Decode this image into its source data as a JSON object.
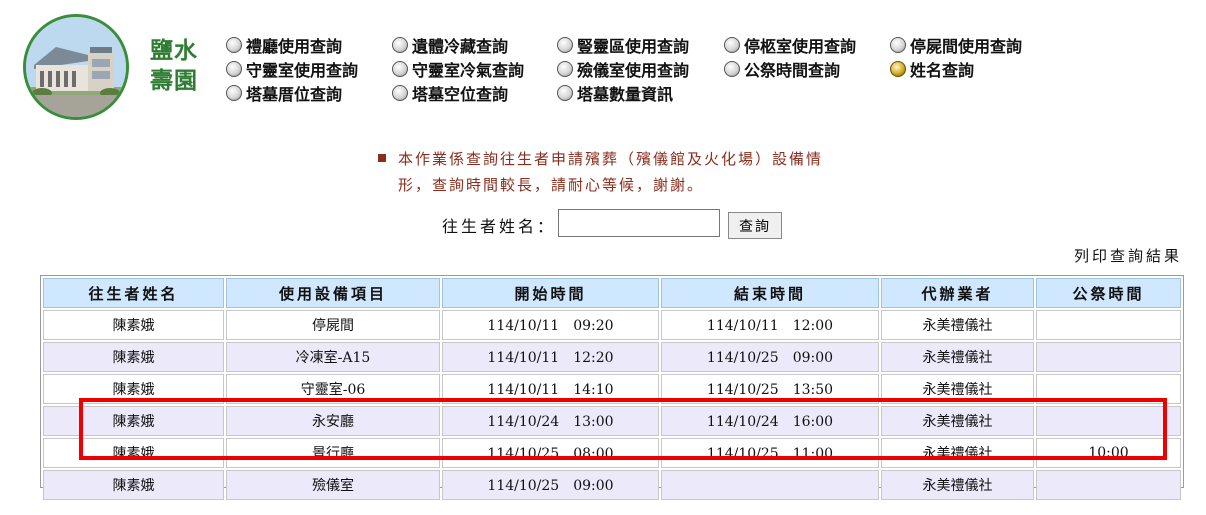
{
  "brand": {
    "line1": "鹽水",
    "line2": "壽園"
  },
  "nav": [
    {
      "label": "禮廳使用查詢",
      "selected": false
    },
    {
      "label": "遺體冷藏查詢",
      "selected": false
    },
    {
      "label": "豎靈區使用查詢",
      "selected": false
    },
    {
      "label": "停柩室使用查詢",
      "selected": false
    },
    {
      "label": "停屍間使用查詢",
      "selected": false
    },
    {
      "label": "守靈室使用查詢",
      "selected": false
    },
    {
      "label": "守靈室冷氣查詢",
      "selected": false
    },
    {
      "label": "殮儀室使用查詢",
      "selected": false
    },
    {
      "label": "公祭時間查詢",
      "selected": false
    },
    {
      "label": "姓名查詢",
      "selected": true
    },
    {
      "label": "塔墓厝位查詢",
      "selected": false
    },
    {
      "label": "塔墓空位查詢",
      "selected": false
    },
    {
      "label": "塔墓數量資訊",
      "selected": false
    }
  ],
  "notice": {
    "line1": "本作業係查詢往生者申請殯葬（殯儀館及火化場）設備情",
    "line2": "形，查詢時間較長，請耐心等候，謝謝。"
  },
  "search": {
    "label": "往生者姓名：",
    "value": "",
    "button": "查詢"
  },
  "print_label": "列印查詢結果",
  "table": {
    "headers": [
      "往生者姓名",
      "使用設備項目",
      "開始時間",
      "結束時間",
      "代辦業者",
      "公祭時間"
    ],
    "rows": [
      [
        "陳素娥",
        "停屍間",
        "114/10/11　09:20",
        "114/10/11　12:00",
        "永美禮儀社",
        ""
      ],
      [
        "陳素娥",
        "冷凍室-A15",
        "114/10/11　12:20",
        "114/10/25　09:00",
        "永美禮儀社",
        ""
      ],
      [
        "陳素娥",
        "守靈室-06",
        "114/10/11　14:10",
        "114/10/25　13:50",
        "永美禮儀社",
        ""
      ],
      [
        "陳素娥",
        "永安廳",
        "114/10/24　13:00",
        "114/10/24　16:00",
        "永美禮儀社",
        ""
      ],
      [
        "陳素娥",
        "景行廳",
        "114/10/25　08:00",
        "114/10/25　11:00",
        "永美禮儀社",
        "10:00"
      ],
      [
        "陳素娥",
        "殮儀室",
        "114/10/25　09:00",
        "",
        "永美禮儀社",
        ""
      ]
    ]
  },
  "colors": {
    "brand": "#2e7d32",
    "notice": "#8b2e1e",
    "header_bg": "#cfe8ff",
    "alt_row": "#ece9fb",
    "highlight": "#ee0000"
  }
}
